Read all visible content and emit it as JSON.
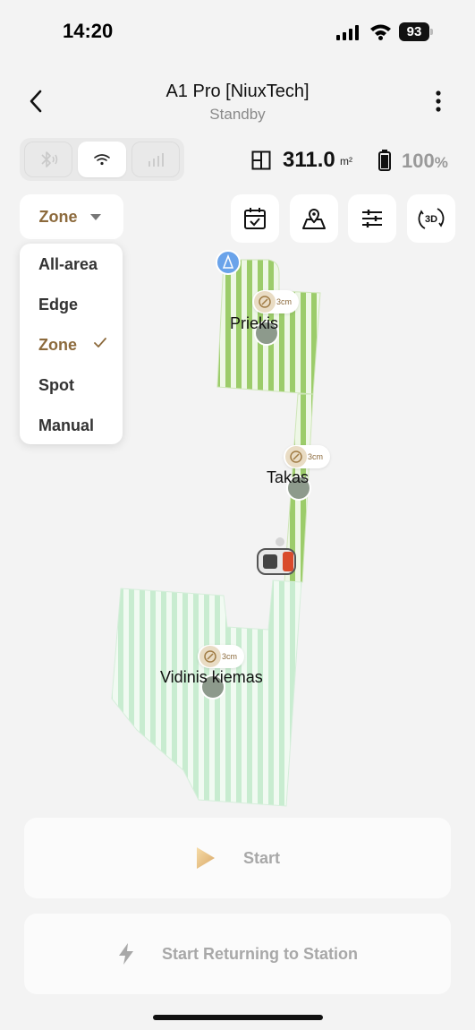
{
  "status_bar": {
    "time": "14:20",
    "battery": "93"
  },
  "header": {
    "title": "A1 Pro [NiuxTech]",
    "subtitle": "Standby"
  },
  "connectivity": {
    "bluetooth_icon": "bluetooth-icon",
    "wifi_icon": "wifi-icon",
    "cellular_icon": "cellular-icon",
    "active": "wifi"
  },
  "stats": {
    "area_value": "311.0",
    "area_unit": "m²",
    "battery_value": "100",
    "battery_unit": "%"
  },
  "mode": {
    "selected": "Zone",
    "options": [
      "All-area",
      "Edge",
      "Zone",
      "Spot",
      "Manual"
    ]
  },
  "toolbar": {
    "icons": [
      "calendar-check-icon",
      "map-icon",
      "sliders-icon",
      "3d-view-icon"
    ],
    "view_3d_label": "3D"
  },
  "map": {
    "zones": [
      {
        "name": "Priekis",
        "cut_height": "3cm"
      },
      {
        "name": "Takas",
        "cut_height": "3cm"
      },
      {
        "name": "Vidinis kiemas",
        "cut_height": "3cm"
      }
    ],
    "colors": {
      "zone_dark": "#9ccc6a",
      "zone_light": "#c8ecd0",
      "accent": "#8c6a3c"
    }
  },
  "actions": {
    "start_label": "Start",
    "return_label": "Start Returning to Station"
  }
}
